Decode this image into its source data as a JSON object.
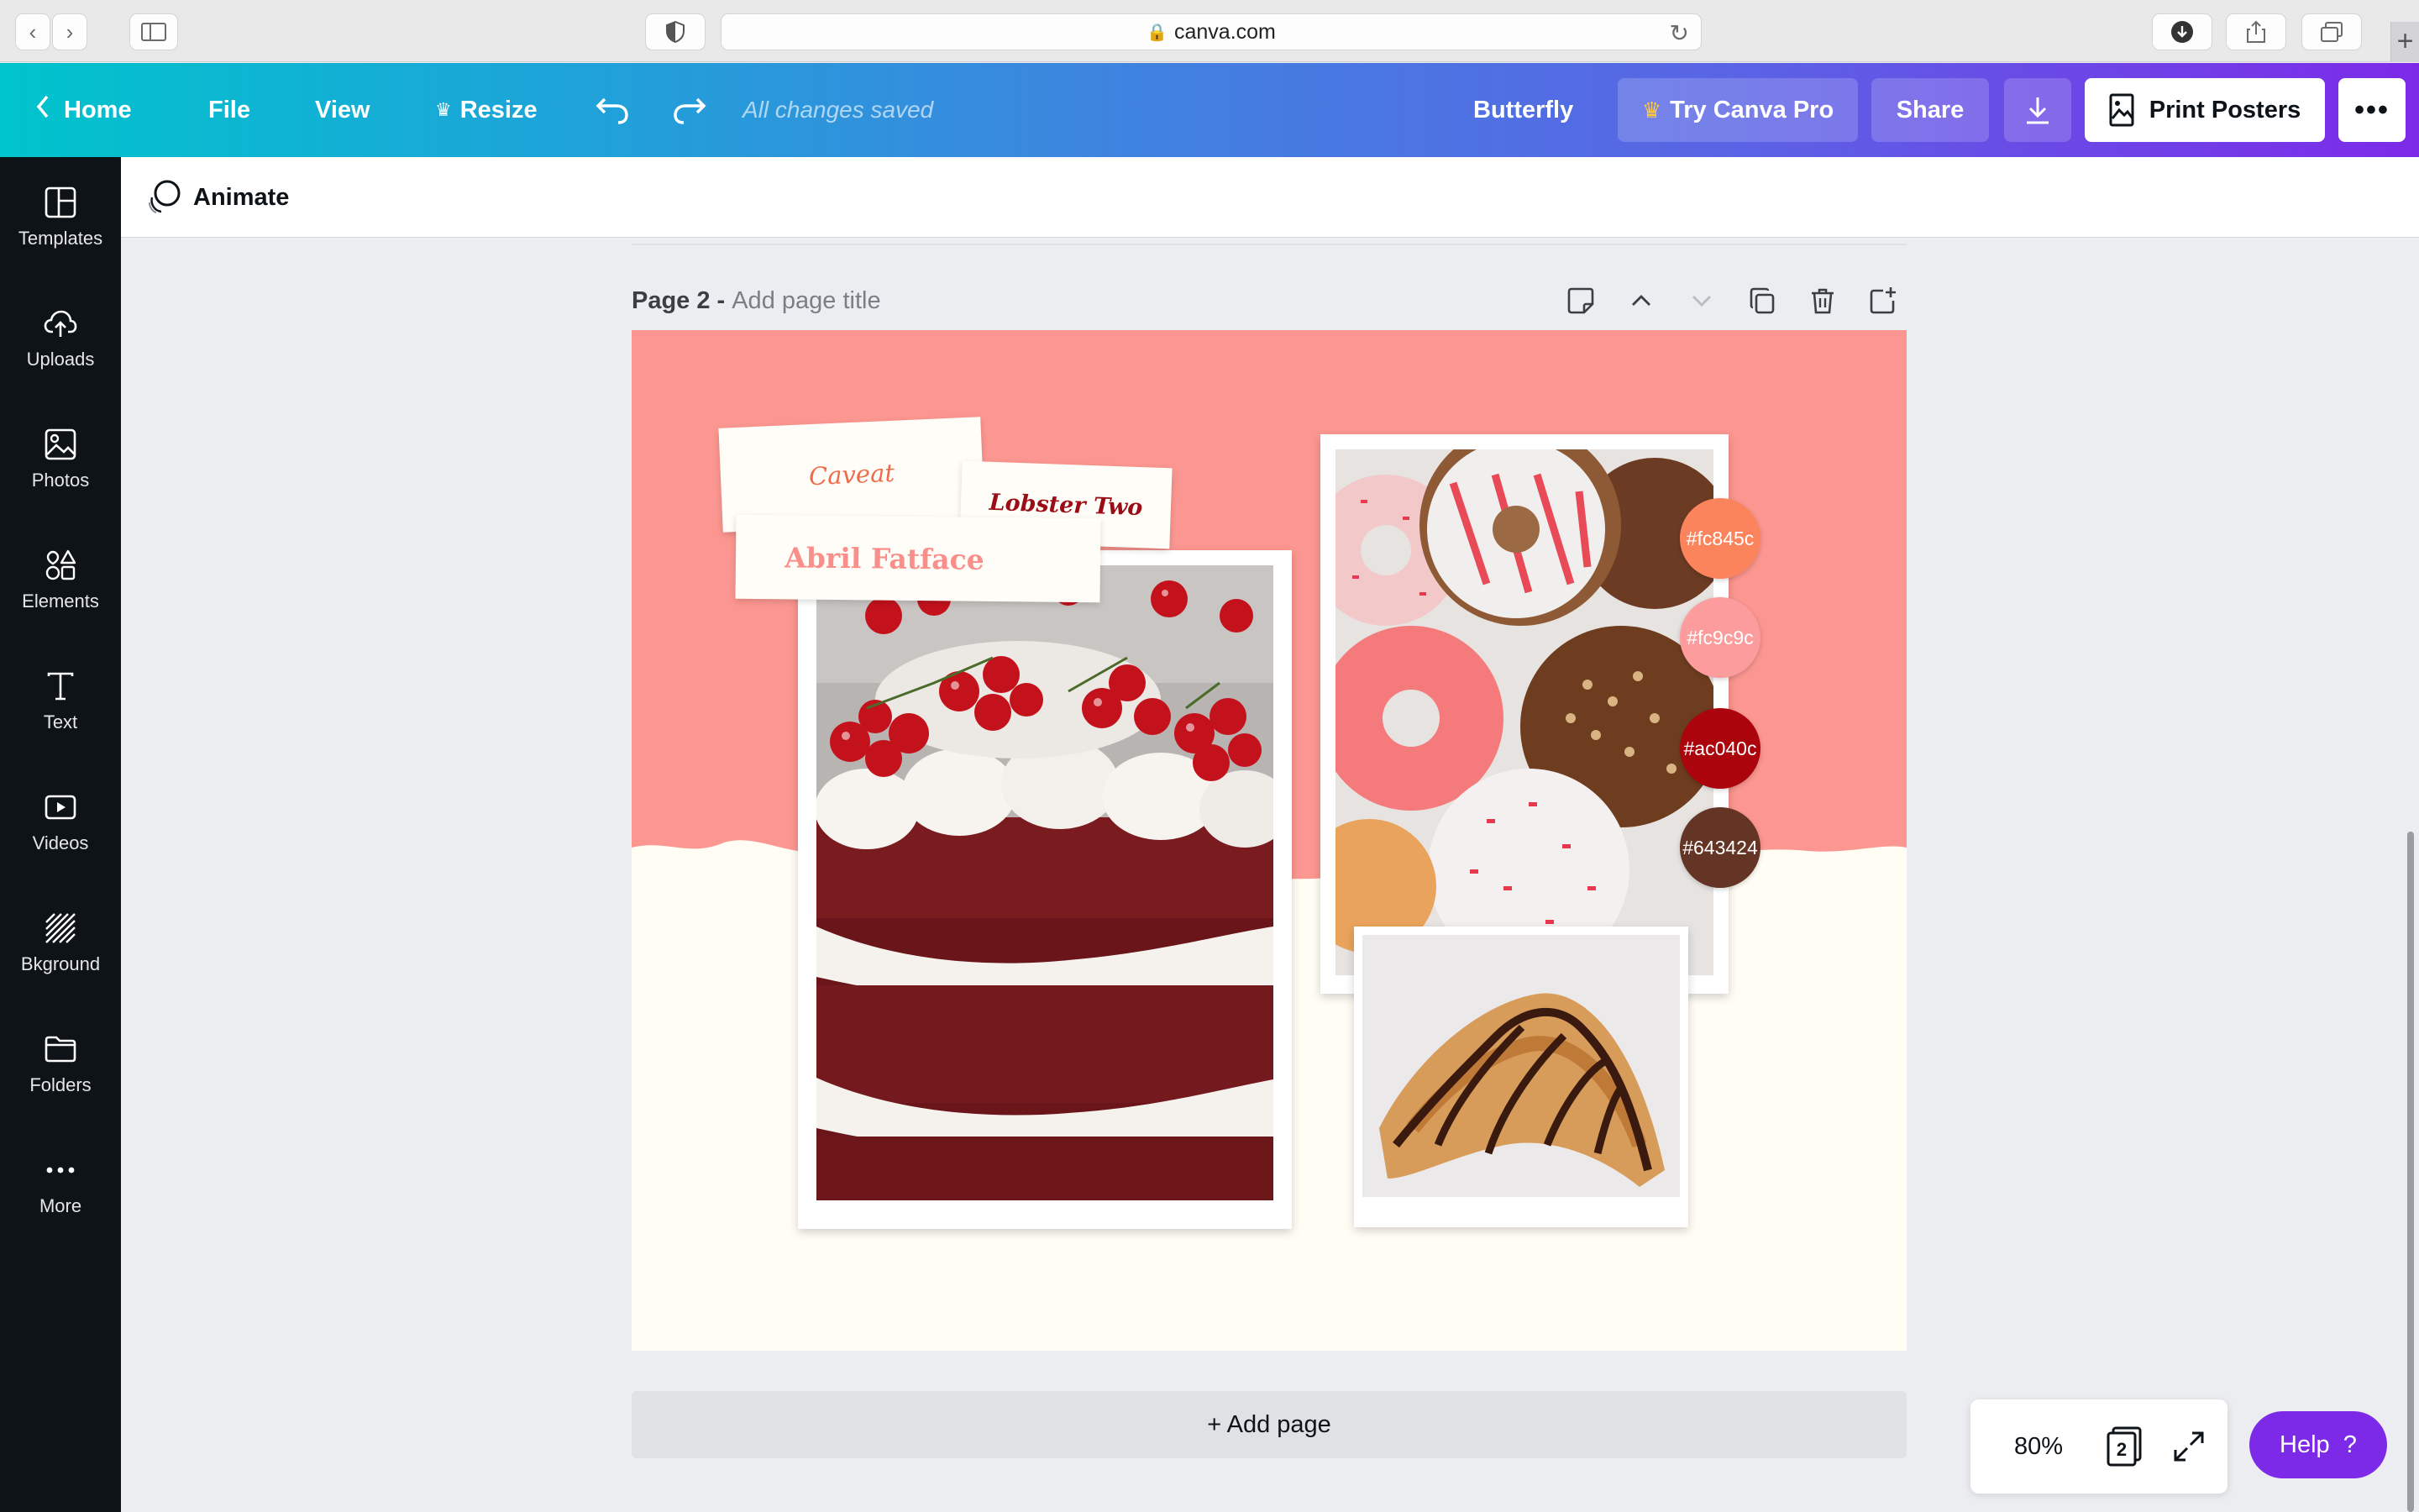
{
  "browser": {
    "url": "canva.com"
  },
  "topbar": {
    "home": "Home",
    "file": "File",
    "view": "View",
    "resize": "Resize",
    "saved_status": "All changes saved",
    "design_name": "Butterfly",
    "try_pro": "Try Canva Pro",
    "share": "Share",
    "print": "Print Posters"
  },
  "sidebar": {
    "items": [
      {
        "label": "Templates",
        "icon": "templates-icon"
      },
      {
        "label": "Uploads",
        "icon": "cloud-upload-icon"
      },
      {
        "label": "Photos",
        "icon": "image-icon"
      },
      {
        "label": "Elements",
        "icon": "shapes-icon"
      },
      {
        "label": "Text",
        "icon": "text-icon"
      },
      {
        "label": "Videos",
        "icon": "play-icon"
      },
      {
        "label": "Bkground",
        "icon": "hatch-icon"
      },
      {
        "label": "Folders",
        "icon": "folder-icon"
      },
      {
        "label": "More",
        "icon": "dots-icon"
      }
    ]
  },
  "animate": {
    "label": "Animate"
  },
  "page": {
    "number": "Page 2 -",
    "title_placeholder": "Add page title"
  },
  "design": {
    "fonts": [
      "Caveat",
      "Lobster Two",
      "Abril Fatface"
    ],
    "swatches": [
      {
        "hex": "#fc845c",
        "color": "#fc845c"
      },
      {
        "hex": "#fc9c9c",
        "color": "#fc9c9c"
      },
      {
        "hex": "#ac040c",
        "color": "#ac040c"
      },
      {
        "hex": "#643424",
        "color": "#643424"
      }
    ],
    "background_colors": {
      "pink": "#fc9690",
      "cream": "#fffdf4"
    }
  },
  "add_page": "+ Add page",
  "zoom": {
    "level": "80%",
    "page_count": "2"
  },
  "help": "Help  ?"
}
